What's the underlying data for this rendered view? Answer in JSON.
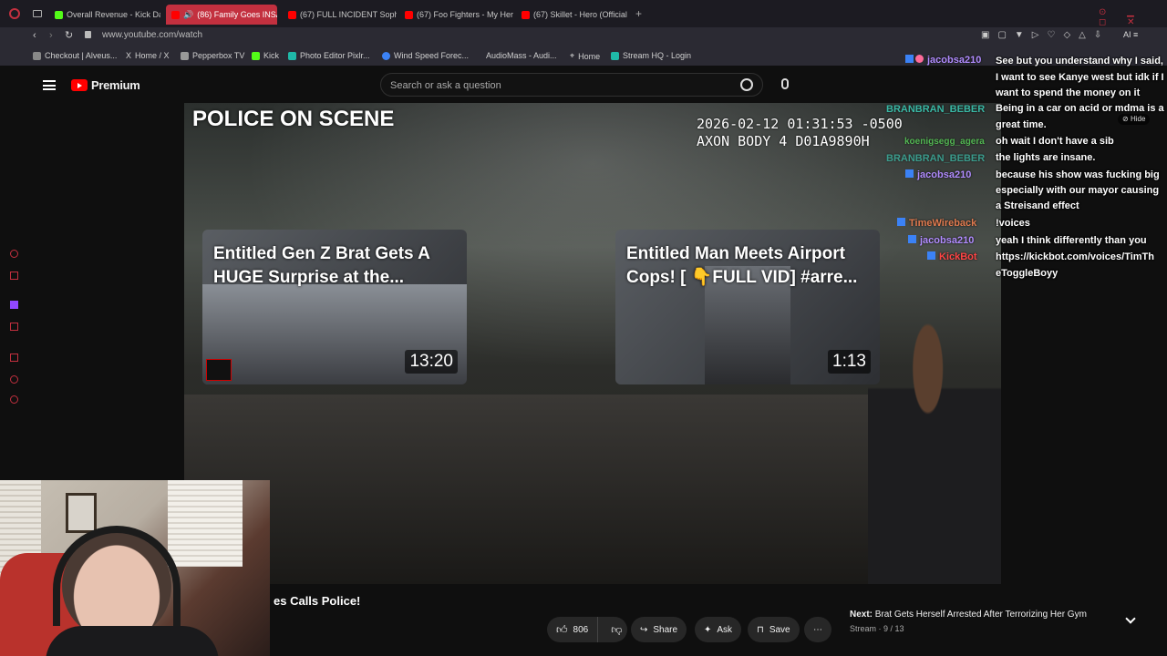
{
  "browser": {
    "tabs": [
      {
        "label": "Overall Revenue - Kick Da",
        "color": "#53fc18"
      },
      {
        "label": "(86) Family Goes INSA",
        "color": "#ff0000"
      },
      {
        "label": "(67) FULL INCIDENT Soph",
        "color": "#ff0000"
      },
      {
        "label": "(67) Foo Fighters - My Her",
        "color": "#ff0000"
      },
      {
        "label": "(67) Skillet - Hero (Official",
        "color": "#ff0000"
      }
    ],
    "url": "www.youtube.com/watch",
    "bookmarks": [
      "Checkout | Alveus...",
      "Home / X",
      "Pepperbox TV",
      "Kick",
      "Photo Editor Pixlr...",
      "Wind Speed Forec...",
      "AudioMass - Audi...",
      "Home",
      "Stream HQ - Login"
    ]
  },
  "youtube": {
    "logo": "Premium",
    "search_placeholder": "Search or ask a question"
  },
  "video": {
    "channel_overlay": "POLICE ON SCENE",
    "timestamp": "2026-02-12 01:31:53 -0500",
    "camera": "AXON BODY 4 D01A9890H",
    "endcards": [
      {
        "title": "Entitled Gen Z Brat Gets A\nHUGE Surprise at the...",
        "duration": "13:20"
      },
      {
        "title": "Entitled Man Meets Airport\nCops! [ 👇FULL VID] #arre...",
        "duration": "1:13"
      }
    ]
  },
  "chat": {
    "hide_label": "Hide",
    "users": [
      {
        "name": "jacobsa210",
        "color": "#b18cff"
      },
      {
        "name": "BRANBRAN_BEBER",
        "color": "#3dd9c2"
      },
      {
        "name": "koenigsegg_agera",
        "color": "#5ad45a"
      },
      {
        "name": "BRANBRAN_BEBER",
        "color": "#3dd9c2"
      },
      {
        "name": "jacobsa210",
        "color": "#b18cff"
      },
      {
        "name": "TimeWireback",
        "color": "#e07a4f"
      },
      {
        "name": "jacobsa210",
        "color": "#b18cff"
      },
      {
        "name": "KickBot",
        "color": "#ff4545"
      }
    ],
    "lines": [
      "See but you understand why I said,",
      "I want to see Kanye west but idk if I",
      "want to spend the money on it",
      "Being in a car on acid or mdma is a",
      "great time.",
      "oh wait I don't have a sib",
      "the lights are insane.",
      "because his show was fucking big",
      "especially with our mayor causing",
      "a Streisand effect",
      "!voices",
      "yeah I think differently than you",
      "https://kickbot.com/voices/TimTh",
      "eToggleBoyy"
    ]
  },
  "below": {
    "title_fragment": "es Calls Police!",
    "likes": "806",
    "share": "Share",
    "ask": "Ask",
    "save": "Save",
    "next_label": "Next:",
    "next_title": "Brat Gets Herself Arrested After Terrorizing Her Gym",
    "stream_info": "Stream · 9 / 13"
  }
}
